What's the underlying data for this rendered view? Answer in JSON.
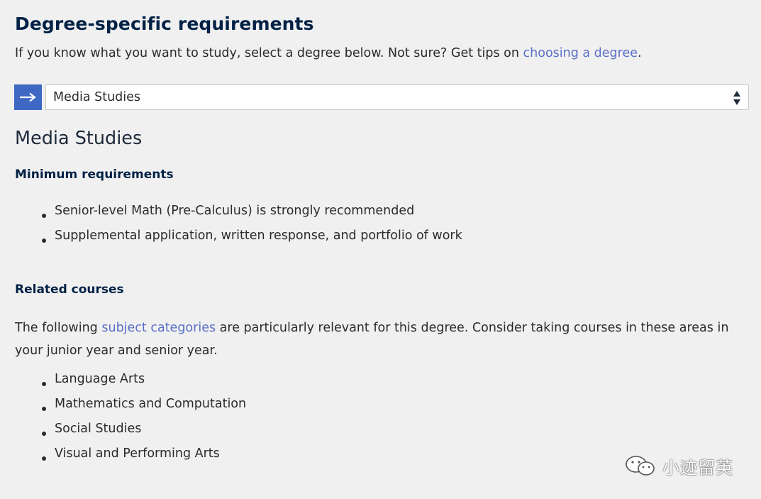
{
  "section": {
    "title": "Degree-specific requirements",
    "intro_prefix": "If you know what you want to study, select a degree below. Not sure? Get tips on ",
    "intro_link": "choosing a degree",
    "intro_suffix": "."
  },
  "degree_select": {
    "selected": "Media Studies",
    "go_icon": "arrow-right-icon",
    "arrows_icon": "select-arrows-icon"
  },
  "degree": {
    "title": "Media Studies",
    "min_req_heading": "Minimum requirements",
    "min_requirements": [
      "Senior-level Math (Pre-Calculus) is strongly recommended",
      "Supplemental application, written response, and portfolio of work"
    ],
    "related_heading": "Related courses",
    "related_prefix": "The following ",
    "related_link": "subject categories",
    "related_suffix": " are particularly relevant for this degree. Consider taking courses in these areas in your junior year and senior year.",
    "courses": [
      "Language Arts",
      "Mathematics and Computation",
      "Social Studies",
      "Visual and Performing Arts"
    ]
  },
  "watermark": {
    "text": "小迹留英",
    "icon": "wechat-icon"
  },
  "colors": {
    "accent": "#3f68c4",
    "link": "#5a6fc9",
    "heading": "#002145",
    "background": "#f0f0f0"
  }
}
